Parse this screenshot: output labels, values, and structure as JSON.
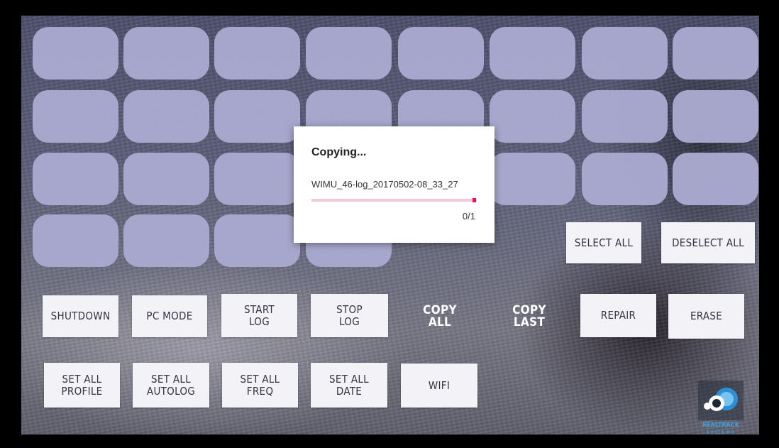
{
  "device_slots": [
    {
      "row": 1,
      "col": 1
    },
    {
      "row": 1,
      "col": 2
    },
    {
      "row": 1,
      "col": 3
    },
    {
      "row": 1,
      "col": 4
    },
    {
      "row": 1,
      "col": 5
    },
    {
      "row": 1,
      "col": 6
    },
    {
      "row": 1,
      "col": 7
    },
    {
      "row": 1,
      "col": 8
    },
    {
      "row": 2,
      "col": 1
    },
    {
      "row": 2,
      "col": 2
    },
    {
      "row": 2,
      "col": 3
    },
    {
      "row": 2,
      "col": 4
    },
    {
      "row": 2,
      "col": 5
    },
    {
      "row": 2,
      "col": 6
    },
    {
      "row": 2,
      "col": 7
    },
    {
      "row": 2,
      "col": 8
    },
    {
      "row": 3,
      "col": 1
    },
    {
      "row": 3,
      "col": 2
    },
    {
      "row": 3,
      "col": 3
    },
    {
      "row": 3,
      "col": 4
    },
    {
      "row": 3,
      "col": 5
    },
    {
      "row": 3,
      "col": 6
    },
    {
      "row": 3,
      "col": 7
    },
    {
      "row": 3,
      "col": 8
    },
    {
      "row": 4,
      "col": 1
    },
    {
      "row": 4,
      "col": 2
    },
    {
      "row": 4,
      "col": 3
    },
    {
      "row": 4,
      "col": 4
    }
  ],
  "selection": {
    "select_all": "SELECT ALL",
    "deselect_all": "DESELECT ALL"
  },
  "actions_row1": {
    "shutdown": "SHUTDOWN",
    "pc_mode": "PC MODE",
    "start_log": "START\nLOG",
    "stop_log": "STOP\nLOG",
    "copy_all": "COPY\nALL",
    "copy_last": "COPY\nLAST",
    "repair": "REPAIR",
    "erase": "ERASE"
  },
  "actions_row2": {
    "set_all_profile": "SET ALL\nPROFILE",
    "set_all_autolog": "SET ALL\nAUTOLOG",
    "set_all_freq": "SET ALL\nFREQ",
    "set_all_date": "SET ALL\nDATE",
    "wifi": "WIFI"
  },
  "copy_dialog": {
    "title": "Copying...",
    "file_name": "WIMU_46-log_20170502-08_33_27",
    "progress_text": "0/1",
    "progress_fraction": 0.02,
    "track_color": "#f1c9d4",
    "fill_color": "#e4155c"
  },
  "logo": {
    "brand": "REALTRACK",
    "tagline": "systems",
    "icon": "realtrack-logo-icon",
    "color": "#3aa2e0"
  }
}
